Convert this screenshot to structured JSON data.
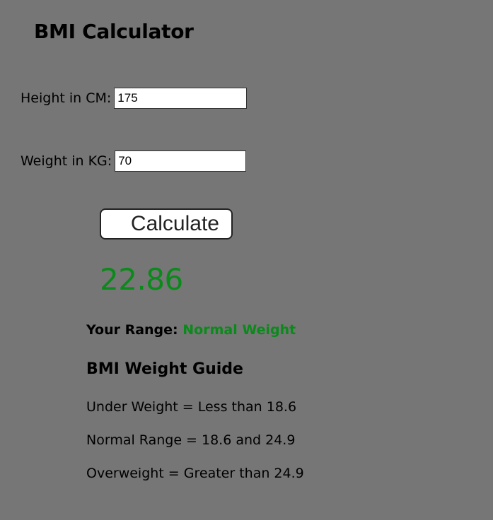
{
  "app": {
    "title": "BMI Calculator"
  },
  "form": {
    "height_label": "Height in CM:",
    "height_value": "175",
    "weight_label": "Weight in KG:",
    "weight_value": "70",
    "calculate_label": "Calculate"
  },
  "result": {
    "bmi": "22.86",
    "range_label": "Your Range:",
    "range_value": "Normal Weight",
    "color": "#0a8a1a"
  },
  "guide": {
    "heading": "BMI Weight Guide",
    "items": [
      "Under Weight = Less than 18.6",
      "Normal Range = 18.6 and 24.9",
      "Overweight = Greater than 24.9"
    ]
  },
  "theme": {
    "background": "#767676"
  }
}
